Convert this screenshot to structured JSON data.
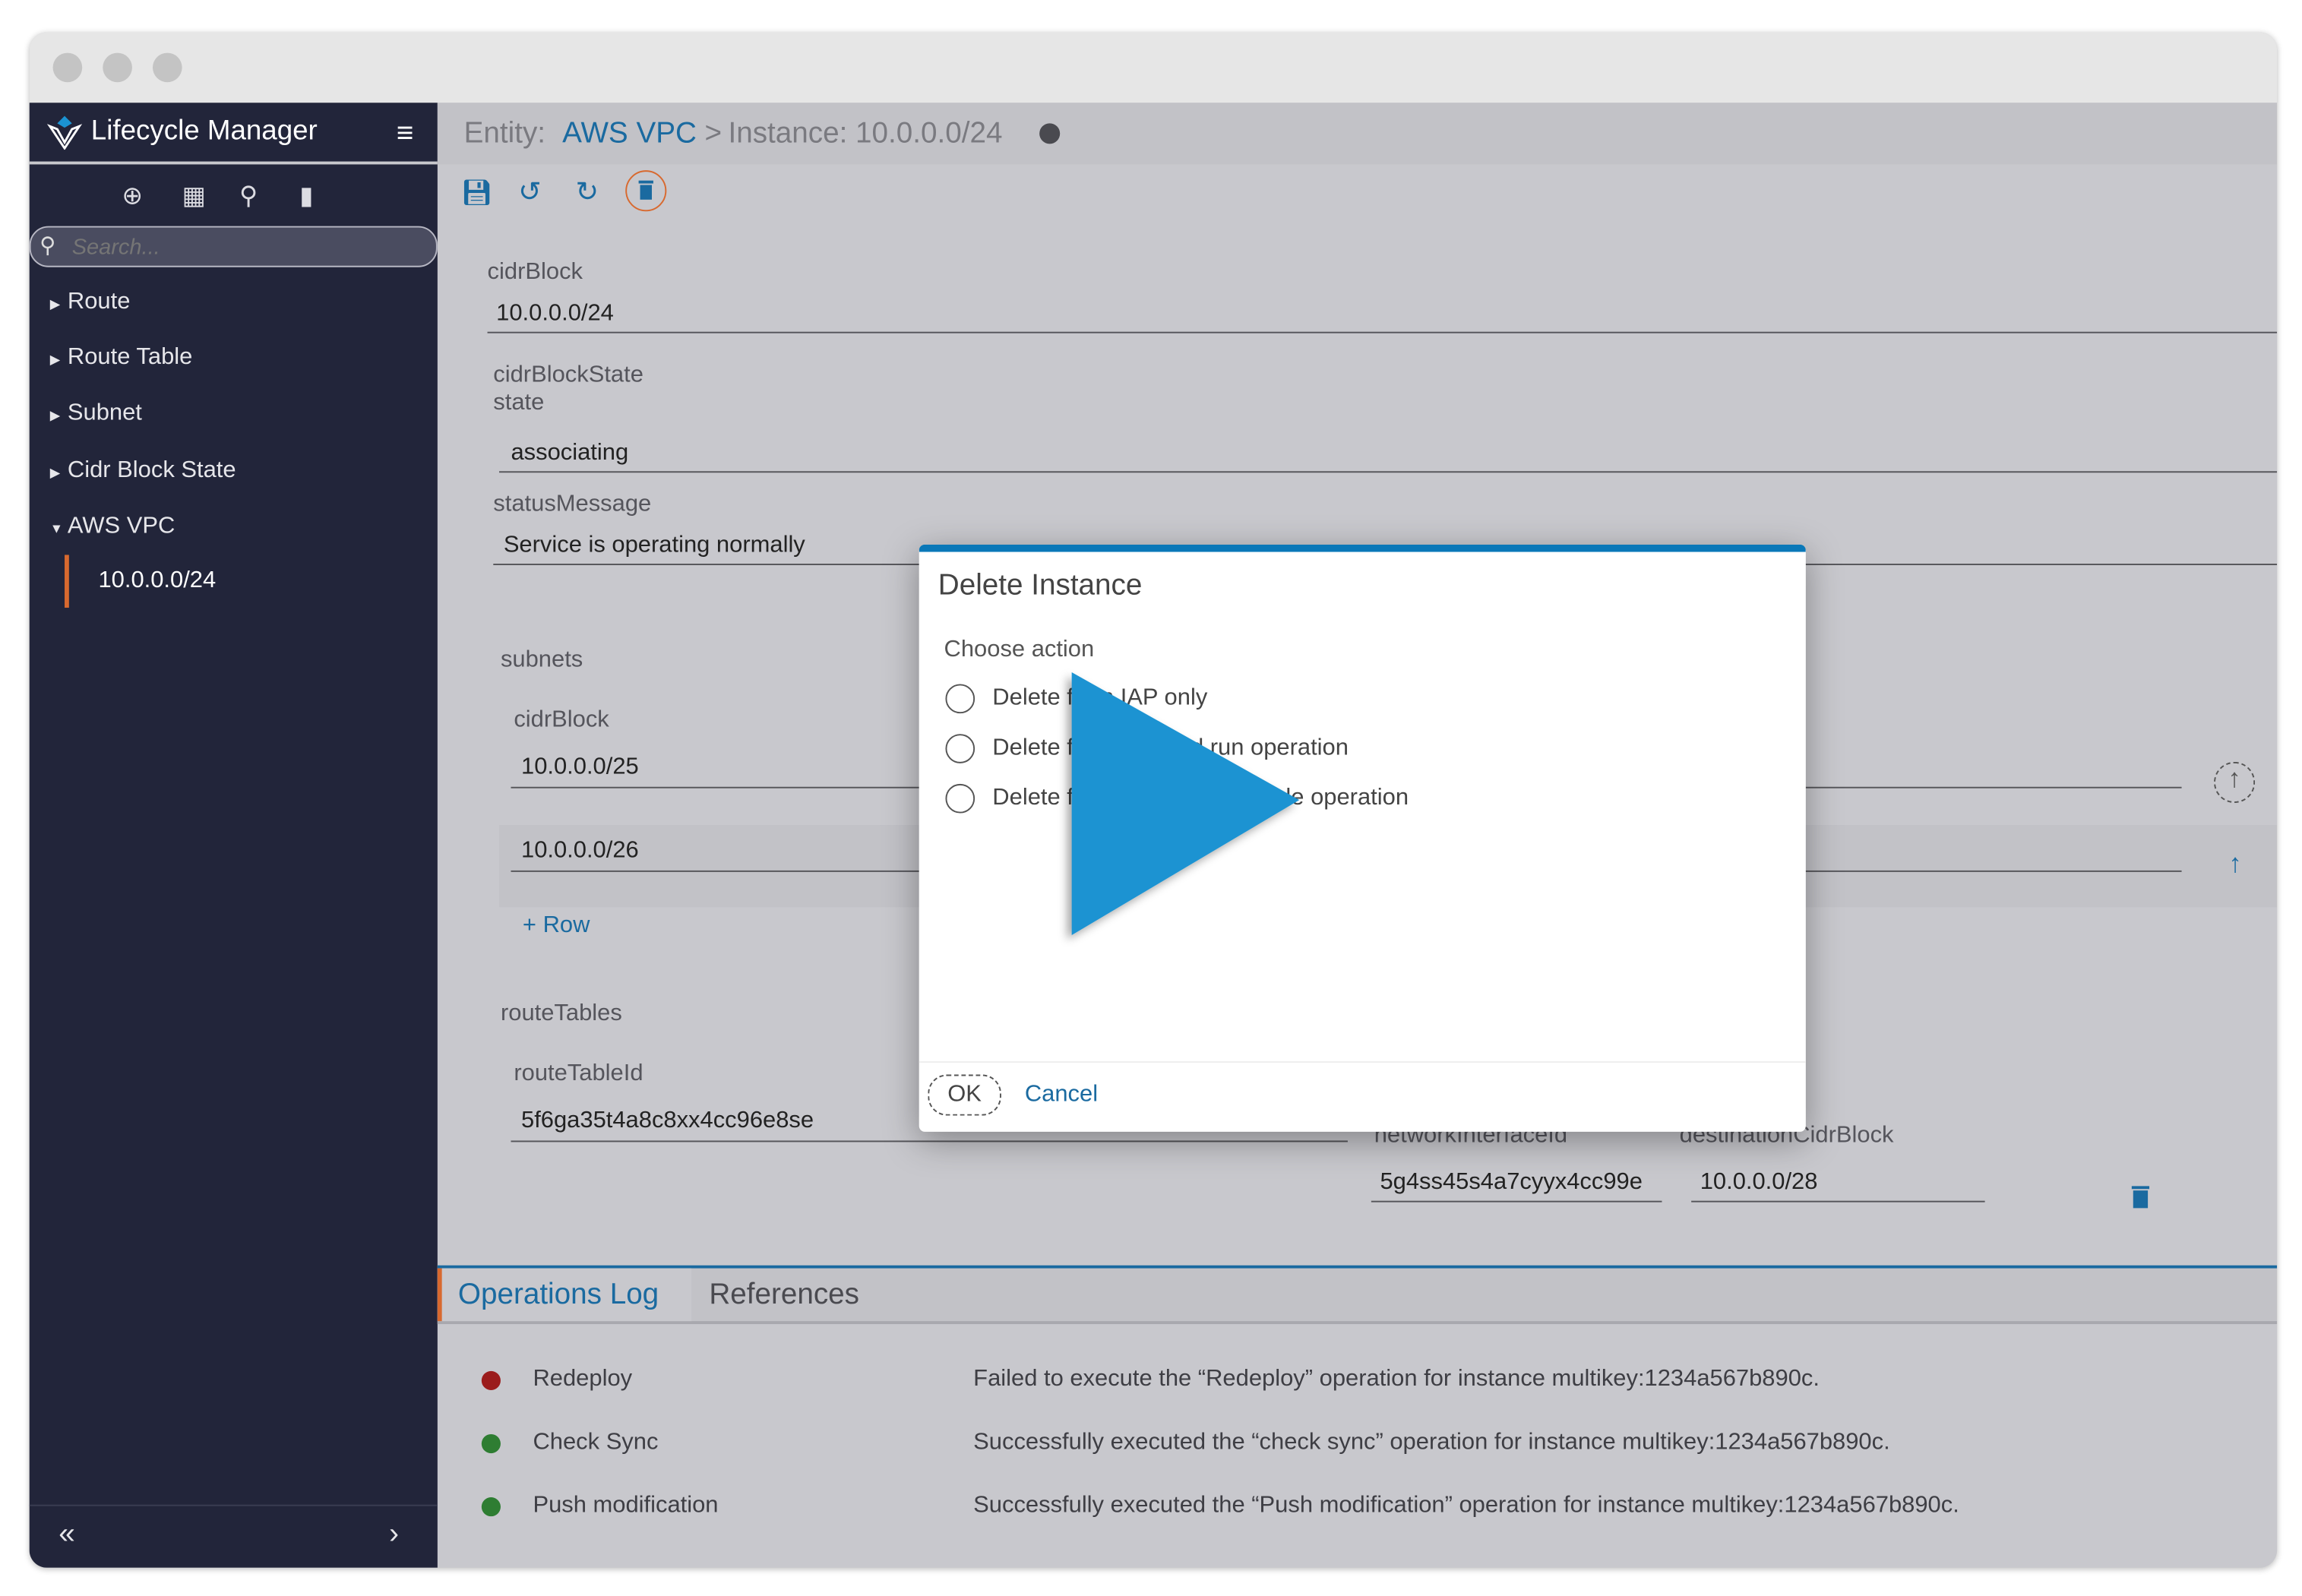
{
  "window": {
    "controls": [
      "close",
      "minimize",
      "maximize"
    ]
  },
  "sidebar": {
    "app_title": "Lifecycle Manager",
    "tools": [
      "add-icon",
      "layout-icon",
      "search-icon",
      "document-icon"
    ],
    "search_placeholder": "Search...",
    "tree": [
      {
        "label": "Route",
        "expanded": false
      },
      {
        "label": "Route Table",
        "expanded": false
      },
      {
        "label": "Subnet",
        "expanded": false
      },
      {
        "label": "Cidr Block State",
        "expanded": false
      },
      {
        "label": "AWS VPC",
        "expanded": true,
        "children": [
          "10.0.0.0/24"
        ]
      }
    ],
    "collapse_icon": "«",
    "expand_icon": "›"
  },
  "header": {
    "entity_label": "Entity:",
    "entity": "AWS VPC",
    "sep": ">",
    "instance": "Instance: 10.0.0.0/24"
  },
  "toolbar": [
    "save-icon",
    "undo-icon",
    "redo-icon",
    "trash-icon"
  ],
  "form": {
    "cidrBlock_label": "cidrBlock",
    "cidrBlock": "10.0.0.0/24",
    "cidrBlockState_label": "cidrBlockState",
    "state_label": "state",
    "state": "associating",
    "statusMessage_label": "statusMessage",
    "statusMessage": "Service is operating normally",
    "subnets_label": "subnets",
    "subnet_cidr_label": "cidrBlock",
    "subnets": [
      "10.0.0.0/25",
      "10.0.0.0/26"
    ],
    "add_row": "Row",
    "routeTables_label": "routeTables",
    "routeTableId_label": "routeTableId",
    "routeTableId": "5f6ga35t4a8c8xx4cc96e8se",
    "networkInterfaceId_label": "networkInterfaceId",
    "networkInterfaceId": "5g4ss45s4a7cyyx4cc99e",
    "destinationCidrBlock_label": "destinationCidrBlock",
    "destinationCidrBlock": "10.0.0.0/28"
  },
  "dialog": {
    "title": "Delete Instance",
    "prompt": "Choose action",
    "options": [
      "Delete from IAP only",
      "Delete from IAP and run operation",
      "Delete from IAP and schedule operation"
    ],
    "ok": "OK",
    "cancel": "Cancel"
  },
  "tabs": [
    {
      "label": "Operations Log",
      "active": true
    },
    {
      "label": "References",
      "active": false
    }
  ],
  "log": [
    {
      "name": "Redeploy",
      "status": "error",
      "message": "Failed to execute the “Redeploy” operation for instance multikey:1234a567b890c."
    },
    {
      "name": "Check Sync",
      "status": "success",
      "message": "Successfully executed the “check sync” operation for instance multikey:1234a567b890c."
    },
    {
      "name": "Push modification",
      "status": "success",
      "message": "Successfully executed the “Push modification” operation for instance multikey:1234a567b890c."
    }
  ],
  "colors": {
    "accent": "#1a6aa0",
    "sidebar": "#22253a",
    "error": "#9b1c1c",
    "success": "#2e7d32",
    "play": "#1b93d2",
    "highlight": "#d8692f"
  },
  "overlay": {
    "play_icon": "play-icon"
  }
}
